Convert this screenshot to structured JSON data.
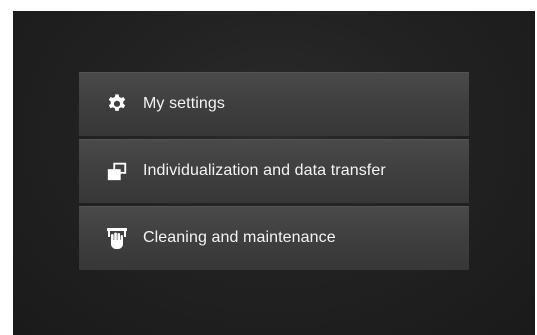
{
  "menu": {
    "items": [
      {
        "label": "My settings",
        "icon": "gear-icon"
      },
      {
        "label": "Individualization and data transfer",
        "icon": "data-transfer-icon"
      },
      {
        "label": "Cleaning and maintenance",
        "icon": "cleaning-hand-icon"
      }
    ]
  },
  "colors": {
    "screen_background": "#222222",
    "menu_item_background": "#434343",
    "text": "#f4f4f4",
    "icon": "#ffffff"
  }
}
